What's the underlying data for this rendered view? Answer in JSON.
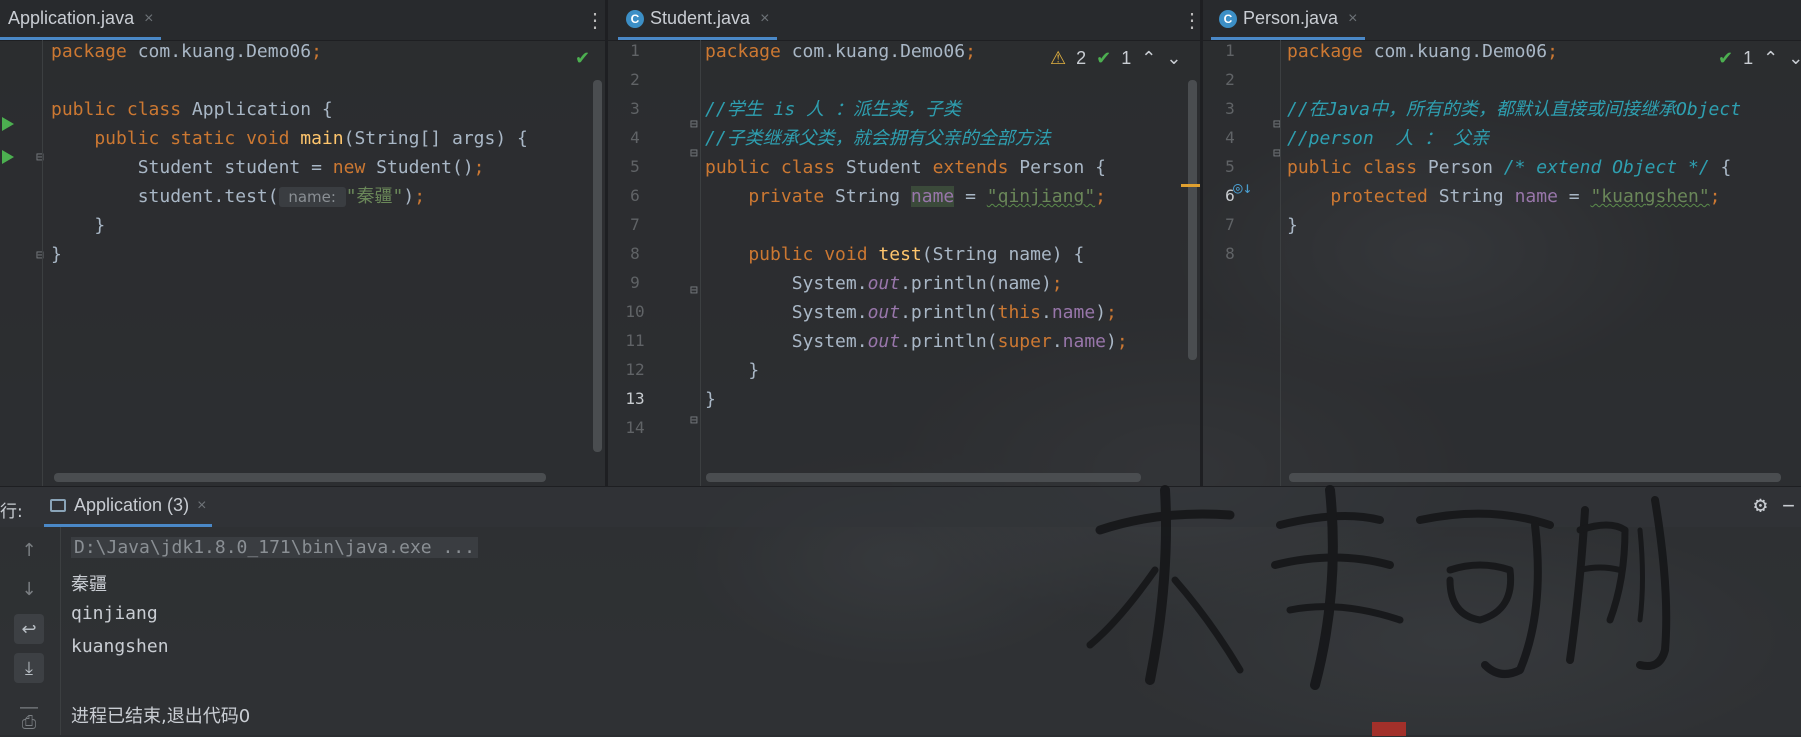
{
  "panes": [
    {
      "tab": {
        "title": "Application.java",
        "close": "×"
      },
      "line_numbers": [],
      "lines": [
        [
          {
            "t": "package ",
            "c": "kw"
          },
          {
            "t": "com.kuang.Demo06",
            "c": "plain"
          },
          {
            "t": ";",
            "c": "kw"
          }
        ],
        [],
        [
          {
            "t": "public class ",
            "c": "kw"
          },
          {
            "t": "Application {",
            "c": "plain"
          }
        ],
        [
          {
            "t": "    public static void ",
            "c": "kw"
          },
          {
            "t": "main",
            "c": "fn"
          },
          {
            "t": "(String[] args) {",
            "c": "plain"
          }
        ],
        [
          {
            "t": "        Student student = ",
            "c": "plain"
          },
          {
            "t": "new ",
            "c": "kw"
          },
          {
            "t": "Student()",
            "c": "plain"
          },
          {
            "t": ";",
            "c": "kw"
          }
        ],
        [
          {
            "t": "        student.test(",
            "c": "plain"
          },
          {
            "t": " name: ",
            "c": "hint"
          },
          {
            "t": "\"秦疆\"",
            "c": "str"
          },
          {
            "t": ")",
            "c": "plain"
          },
          {
            "t": ";",
            "c": "kw"
          }
        ],
        [
          {
            "t": "    }",
            "c": "plain"
          }
        ],
        [
          {
            "t": "}",
            "c": "plain"
          }
        ]
      ]
    },
    {
      "tab": {
        "title": "Student.java",
        "close": "×"
      },
      "line_numbers": [
        "1",
        "2",
        "3",
        "4",
        "5",
        "6",
        "7",
        "8",
        "9",
        "10",
        "11",
        "12",
        "13",
        "14"
      ],
      "current_line": "13",
      "inspection": {
        "warnings": "2",
        "weak_warnings": "1"
      },
      "lines": [
        [
          {
            "t": "package ",
            "c": "kw"
          },
          {
            "t": "com.kuang.Demo06",
            "c": "plain"
          },
          {
            "t": ";",
            "c": "kw"
          }
        ],
        [],
        [
          {
            "t": "//学生 is 人 ：派生类，子类",
            "c": "cmt"
          }
        ],
        [
          {
            "t": "//子类继承父类，就会拥有父亲的全部方法",
            "c": "cmt"
          }
        ],
        [
          {
            "t": "public class ",
            "c": "kw"
          },
          {
            "t": "Student ",
            "c": "plain"
          },
          {
            "t": "extends ",
            "c": "kw"
          },
          {
            "t": "Person {",
            "c": "plain"
          }
        ],
        [
          {
            "t": "    private ",
            "c": "kw"
          },
          {
            "t": "String ",
            "c": "plain"
          },
          {
            "t": "name",
            "c": "fld hl-name"
          },
          {
            "t": " = ",
            "c": "plain"
          },
          {
            "t": "\"qinjiang\"",
            "c": "str squig"
          },
          {
            "t": ";",
            "c": "kw"
          }
        ],
        [],
        [
          {
            "t": "    public void ",
            "c": "kw"
          },
          {
            "t": "test",
            "c": "fn"
          },
          {
            "t": "(String name) {",
            "c": "plain"
          }
        ],
        [
          {
            "t": "        System.",
            "c": "plain"
          },
          {
            "t": "out",
            "c": "sfld"
          },
          {
            "t": ".println(name)",
            "c": "plain"
          },
          {
            "t": ";",
            "c": "kw"
          }
        ],
        [
          {
            "t": "        System.",
            "c": "plain"
          },
          {
            "t": "out",
            "c": "sfld"
          },
          {
            "t": ".println(",
            "c": "plain"
          },
          {
            "t": "this",
            "c": "kw"
          },
          {
            "t": ".",
            "c": "plain"
          },
          {
            "t": "name",
            "c": "fld"
          },
          {
            "t": ")",
            "c": "plain"
          },
          {
            "t": ";",
            "c": "kw"
          }
        ],
        [
          {
            "t": "        System.",
            "c": "plain"
          },
          {
            "t": "out",
            "c": "sfld"
          },
          {
            "t": ".println(",
            "c": "plain"
          },
          {
            "t": "super",
            "c": "kw"
          },
          {
            "t": ".",
            "c": "plain"
          },
          {
            "t": "name",
            "c": "fld"
          },
          {
            "t": ")",
            "c": "plain"
          },
          {
            "t": ";",
            "c": "kw"
          }
        ],
        [
          {
            "t": "    }",
            "c": "plain"
          }
        ],
        [
          {
            "t": "}",
            "c": "plain"
          }
        ]
      ]
    },
    {
      "tab": {
        "title": "Person.java",
        "close": "×"
      },
      "line_numbers": [
        "1",
        "2",
        "3",
        "4",
        "5",
        "6",
        "7",
        "8"
      ],
      "current_line": "6",
      "inspection": {
        "weak_warnings": "1"
      },
      "lines": [
        [
          {
            "t": "package ",
            "c": "kw"
          },
          {
            "t": "com.kuang.Demo06",
            "c": "plain"
          },
          {
            "t": ";",
            "c": "kw"
          }
        ],
        [],
        [
          {
            "t": "//在Java中，所有的类，都默认直接或间接继承Object",
            "c": "cmt"
          }
        ],
        [
          {
            "t": "//person  人 ： 父亲",
            "c": "cmt"
          }
        ],
        [
          {
            "t": "public class ",
            "c": "kw"
          },
          {
            "t": "Person ",
            "c": "plain"
          },
          {
            "t": "/* extend Object */ ",
            "c": "cmt"
          },
          {
            "t": "{",
            "c": "plain"
          }
        ],
        [
          {
            "t": "    protected ",
            "c": "kw"
          },
          {
            "t": "String ",
            "c": "plain"
          },
          {
            "t": "name",
            "c": "fld"
          },
          {
            "t": " = ",
            "c": "plain"
          },
          {
            "t": "\"kuangshen\"",
            "c": "str squig"
          },
          {
            "t": ";",
            "c": "kw"
          }
        ],
        [
          {
            "t": "}",
            "c": "plain"
          }
        ]
      ]
    }
  ],
  "run_panel": {
    "label": "行:",
    "tab_title": "Application (3)",
    "tab_close": "×",
    "settings_icon": "gear-icon",
    "minimize_icon": "minus-icon",
    "console_lines": [
      "D:\\Java\\jdk1.8.0_171\\bin\\java.exe ...",
      "秦疆",
      "qinjiang",
      "kuangshen",
      "",
      "进程已结束,退出代码0"
    ]
  },
  "watermark": {
    "calligraphy": "未来可期"
  }
}
